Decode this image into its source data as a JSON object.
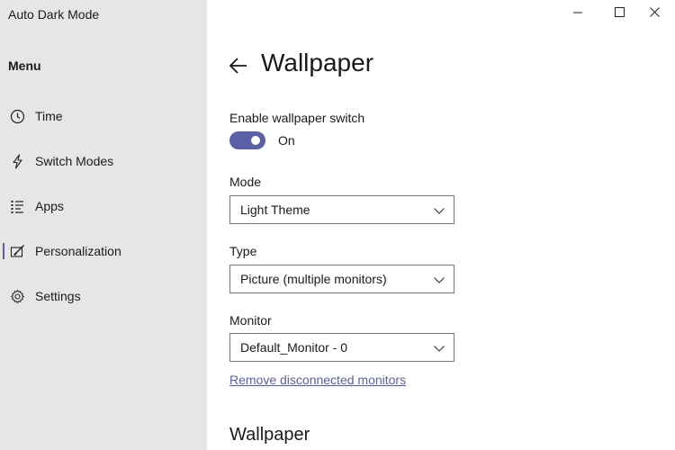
{
  "app": {
    "title": "Auto Dark Mode"
  },
  "sidebar": {
    "menu_heading": "Menu",
    "items": [
      {
        "label": "Time",
        "icon": "clock-icon"
      },
      {
        "label": "Switch Modes",
        "icon": "lightning-icon"
      },
      {
        "label": "Apps",
        "icon": "list-icon"
      },
      {
        "label": "Personalization",
        "icon": "personalization-icon",
        "selected": true
      },
      {
        "label": "Settings",
        "icon": "gear-icon"
      }
    ]
  },
  "window": {
    "controls": [
      "minimize",
      "maximize",
      "close"
    ]
  },
  "page": {
    "title": "Wallpaper"
  },
  "wallpaper_switch": {
    "label": "Enable wallpaper switch",
    "state": "On",
    "enabled": true
  },
  "mode": {
    "label": "Mode",
    "value": "Light Theme"
  },
  "type": {
    "label": "Type",
    "value": "Picture (multiple monitors)"
  },
  "monitor": {
    "label": "Monitor",
    "value": "Default_Monitor - 0"
  },
  "remove_link": {
    "label": "Remove disconnected monitors"
  },
  "section": {
    "title": "Wallpaper"
  },
  "colors": {
    "accent": "#5a5fa7",
    "sidebar_bg": "#e6e6e6"
  }
}
